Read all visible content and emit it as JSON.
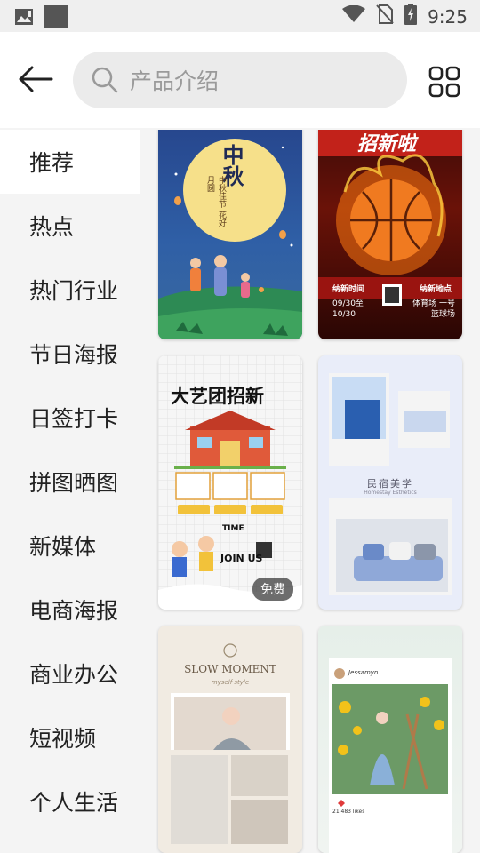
{
  "status_bar": {
    "time": "9:25"
  },
  "search": {
    "placeholder": "产品介绍"
  },
  "sidebar": {
    "items": [
      {
        "label": "推荐"
      },
      {
        "label": "热点"
      },
      {
        "label": "热门行业"
      },
      {
        "label": "节日海报"
      },
      {
        "label": "日签打卡"
      },
      {
        "label": "拼图晒图"
      },
      {
        "label": "新媒体"
      },
      {
        "label": "电商海报"
      },
      {
        "label": "商业办公"
      },
      {
        "label": "短视频"
      },
      {
        "label": "个人生活"
      }
    ]
  },
  "templates": {
    "mid_autumn": {
      "title_1": "中",
      "title_2": "秋",
      "subtitle": "中秋佳节 花好月圆"
    },
    "basketball": {
      "title": "招新啦",
      "time_label": "纳新时间",
      "place_label": "纳新地点",
      "date": "09/30至 10/30",
      "place": "体育场 一号篮球场"
    },
    "art_troupe": {
      "title": "大艺团招新",
      "time_label": "TIME",
      "join": "JOIN US",
      "free_badge": "免费"
    },
    "homestay": {
      "title": "民宿美学",
      "subtitle": "Homestay Esthetics"
    },
    "slow_moment": {
      "title": "SLOW MOMENT",
      "subtitle": "myself style"
    },
    "sunflower": {
      "username": "Jessamyn",
      "likes": "21,483 likes"
    }
  }
}
